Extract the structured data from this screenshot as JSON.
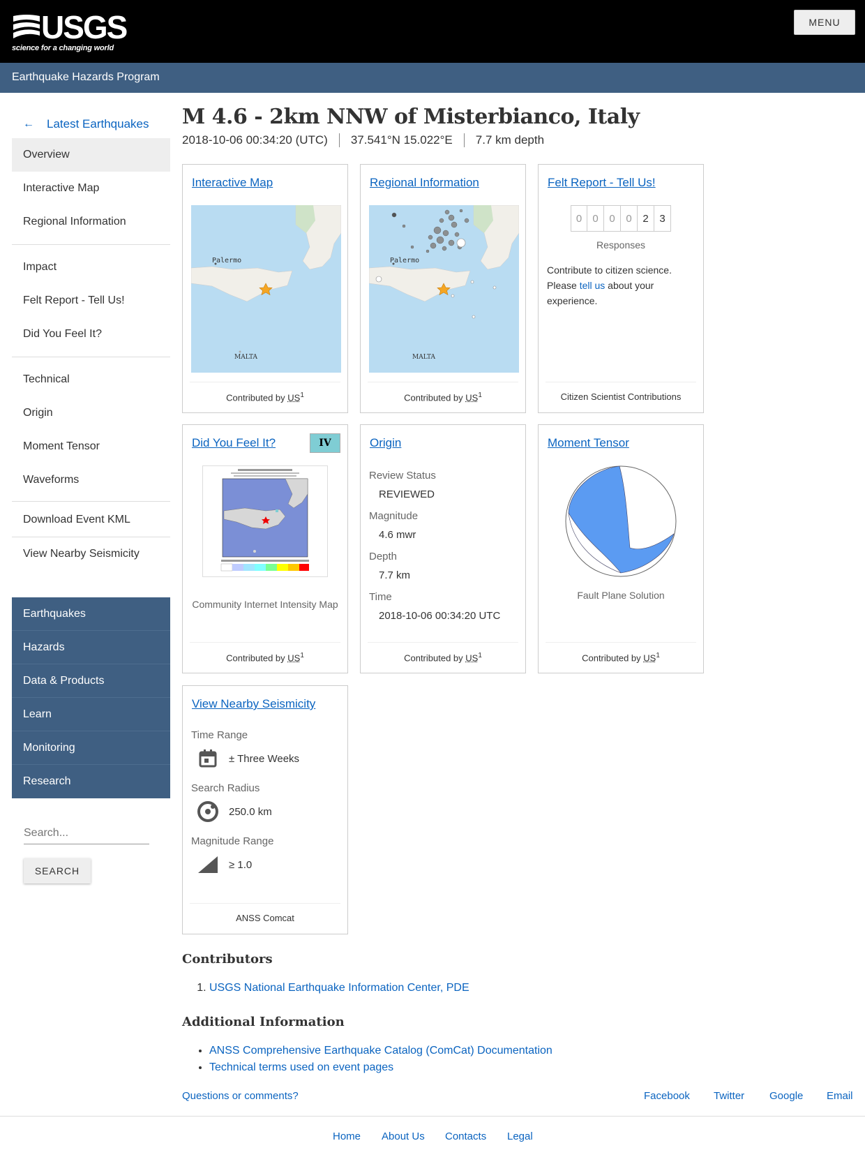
{
  "header": {
    "logo_text": "USGS",
    "logo_tagline": "science for a changing world",
    "menu_label": "MENU",
    "program_title": "Earthquake Hazards Program"
  },
  "sidenav": {
    "back_label": "Latest Earthquakes",
    "groups": [
      [
        "Overview",
        "Interactive Map",
        "Regional Information"
      ],
      [
        "Impact",
        "Felt Report - Tell Us!",
        "Did You Feel It?"
      ],
      [
        "Technical",
        "Origin",
        "Moment Tensor",
        "Waveforms"
      ],
      [
        "Download Event KML"
      ],
      [
        "View Nearby Seismicity"
      ]
    ],
    "active": "Overview"
  },
  "site_nav": [
    "Earthquakes",
    "Hazards",
    "Data & Products",
    "Learn",
    "Monitoring",
    "Research"
  ],
  "search": {
    "placeholder": "Search...",
    "button": "SEARCH"
  },
  "event": {
    "title": "M 4.6 - 2km NNW of Misterbianco, Italy",
    "time": "2018-10-06 00:34:20 (UTC)",
    "location": "37.541°N 15.022°E",
    "depth": "7.7 km depth"
  },
  "cards": {
    "interactive_map": {
      "title": "Interactive Map",
      "footer_prefix": "Contributed by",
      "footer_source": "US",
      "footer_ref": "1",
      "map_labels": {
        "city": "Palermo",
        "island": "MALTA"
      }
    },
    "regional_info": {
      "title": "Regional Information",
      "footer_prefix": "Contributed by",
      "footer_source": "US",
      "footer_ref": "1",
      "map_labels": {
        "city": "Palermo",
        "island": "MALTA"
      }
    },
    "felt_report": {
      "title": "Felt Report - Tell Us!",
      "counter": [
        "0",
        "0",
        "0",
        "0",
        "2",
        "3"
      ],
      "responses_label": "Responses",
      "text_before": "Contribute to citizen science. Please ",
      "link_text": "tell us",
      "text_after": " about your experience.",
      "footer": "Citizen Scientist Contributions"
    },
    "dyfi": {
      "title": "Did You Feel It?",
      "mmi": "IV",
      "mmi_color": "#7fcdd4",
      "caption": "Community Internet Intensity Map",
      "footer_prefix": "Contributed by",
      "footer_source": "US",
      "footer_ref": "1"
    },
    "origin": {
      "title": "Origin",
      "fields": [
        {
          "label": "Review Status",
          "value": "REVIEWED"
        },
        {
          "label": "Magnitude",
          "value": "4.6 mwr"
        },
        {
          "label": "Depth",
          "value": "7.7 km"
        },
        {
          "label": "Time",
          "value": "2018-10-06 00:34:20 UTC"
        }
      ],
      "footer_prefix": "Contributed by",
      "footer_source": "US",
      "footer_ref": "1"
    },
    "moment_tensor": {
      "title": "Moment Tensor",
      "caption": "Fault Plane Solution",
      "beachball_color": "#5b9bf2",
      "footer_prefix": "Contributed by",
      "footer_source": "US",
      "footer_ref": "1"
    },
    "nearby": {
      "title": "View Nearby Seismicity",
      "time_label": "Time Range",
      "time_value": "± Three Weeks",
      "radius_label": "Search Radius",
      "radius_value": "250.0 km",
      "mag_label": "Magnitude Range",
      "mag_value": "≥ 1.0",
      "footer": "ANSS Comcat"
    }
  },
  "contributors": {
    "heading": "Contributors",
    "items": [
      "USGS National Earthquake Information Center, PDE"
    ]
  },
  "additional": {
    "heading": "Additional Information",
    "items": [
      "ANSS Comprehensive Earthquake Catalog (ComCat) Documentation",
      "Technical terms used on event pages"
    ]
  },
  "footer": {
    "questions": "Questions or comments?",
    "social": [
      "Facebook",
      "Twitter",
      "Google",
      "Email"
    ],
    "bottom": [
      "Home",
      "About Us",
      "Contacts",
      "Legal"
    ]
  },
  "colors": {
    "header_bg": "#000000",
    "program_bar": "#3f5f82",
    "link": "#0b64c0",
    "map_water": "#b9dcf2",
    "map_land": "#f1efe9",
    "event_star": "#f5a623"
  }
}
